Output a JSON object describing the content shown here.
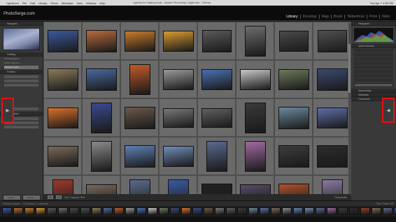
{
  "menubar": {
    "apple": "",
    "items": [
      "Lightroom",
      "File",
      "Edit",
      "Library",
      "Photo",
      "Metadata",
      "View",
      "Window",
      "Help"
    ],
    "window_title": "Lightroom Catalog.lrcat - Adobe Photoshop Lightroom - Library",
    "clock": "Tue Apr 7  4:50 PM"
  },
  "identity": {
    "brand": "PhotoSerge.com"
  },
  "modules": [
    "Library",
    "Develop",
    "Map",
    "Book",
    "Slideshow",
    "Print",
    "Web"
  ],
  "active_module": "Library",
  "left_panel": {
    "navigator": "Navigator",
    "catalog": "Catalog",
    "catalog_rows": [
      "All Photographs",
      "Quick Collection +",
      "Previous Import"
    ],
    "folders": "Folders",
    "collections": "Collections"
  },
  "right_panel": {
    "histogram": "Histogram",
    "quick_develop": "Quick Develop",
    "keywording": "Keywording",
    "metadata": "Metadata",
    "comments": "Comments"
  },
  "toolbar": {
    "sort": "Sort: Capture Time",
    "thumbnails": "Thumbnails"
  },
  "buttons": {
    "import": "Import...",
    "export": "Export..."
  },
  "filmstrip_bar": {
    "source": "Previous Import",
    "count": "122 photos / 1 selected",
    "filter": "Filter: Filters Off"
  },
  "colors": {
    "highlight_border": "#e81010",
    "active_module": "#ffffff"
  },
  "grid_cells": [
    {
      "c": "#3c5a9e",
      "w": 44,
      "h": 32
    },
    {
      "c": "#b76a3a",
      "w": 44,
      "h": 32
    },
    {
      "c": "#c77b2b",
      "w": 44,
      "h": 30
    },
    {
      "c": "#d99a32",
      "w": 44,
      "h": 30
    },
    {
      "c": "#5a5a5a",
      "w": 42,
      "h": 32
    },
    {
      "c": "#6d6d6d",
      "w": 30,
      "h": 44
    },
    {
      "c": "#4a4a4a",
      "w": 42,
      "h": 30
    },
    {
      "c": "#505050",
      "w": 42,
      "h": 32
    },
    {
      "c": "#8a7a5a",
      "w": 44,
      "h": 32
    },
    {
      "c": "#4a6aa0",
      "w": 44,
      "h": 32
    },
    {
      "c": "#c25a2a",
      "w": 30,
      "h": 44
    },
    {
      "c": "#9a9a9a",
      "w": 44,
      "h": 30
    },
    {
      "c": "#4a70b0",
      "w": 44,
      "h": 30
    },
    {
      "c": "#c8c8c8",
      "w": 44,
      "h": 30
    },
    {
      "c": "#6c7a5a",
      "w": 44,
      "h": 30
    },
    {
      "c": "#3a4a70",
      "w": 44,
      "h": 32
    },
    {
      "c": "#d9702a",
      "w": 44,
      "h": 30
    },
    {
      "c": "#3a4a8e",
      "w": 30,
      "h": 44
    },
    {
      "c": "#6a5a4a",
      "w": 44,
      "h": 32
    },
    {
      "c": "#787878",
      "w": 44,
      "h": 28
    },
    {
      "c": "#606060",
      "w": 44,
      "h": 28
    },
    {
      "c": "#3a3a3a",
      "w": 30,
      "h": 44
    },
    {
      "c": "#6a8a9e",
      "w": 44,
      "h": 32
    },
    {
      "c": "#5c6ea8",
      "w": 44,
      "h": 30
    },
    {
      "c": "#7a6a5a",
      "w": 44,
      "h": 30
    },
    {
      "c": "#8a8a8a",
      "w": 30,
      "h": 44
    },
    {
      "c": "#5f80b5",
      "w": 44,
      "h": 32
    },
    {
      "c": "#6f8eb8",
      "w": 44,
      "h": 30
    },
    {
      "c": "#5a6a90",
      "w": 30,
      "h": 44
    },
    {
      "c": "#a06aa0",
      "w": 30,
      "h": 44
    },
    {
      "c": "#3c3c3c",
      "w": 44,
      "h": 32
    },
    {
      "c": "#2c2c2c",
      "w": 44,
      "h": 32
    },
    {
      "c": "#9a3a2a",
      "w": 30,
      "h": 44
    },
    {
      "c": "#7a6a5a",
      "w": 44,
      "h": 30
    },
    {
      "c": "#5a6a8a",
      "w": 30,
      "h": 44
    },
    {
      "c": "#3a5aa0",
      "w": 30,
      "h": 44
    },
    {
      "c": "#222222",
      "w": 44,
      "h": 32
    },
    {
      "c": "#5a4a6a",
      "w": 44,
      "h": 30
    },
    {
      "c": "#b0502a",
      "w": 44,
      "h": 32
    },
    {
      "c": "#8a7aa0",
      "w": 30,
      "h": 44
    }
  ],
  "filmstrip": [
    "#3c5a9e",
    "#b76a3a",
    "#c77b2b",
    "#d99a32",
    "#5a5a5a",
    "#6d6d6d",
    "#4a4a4a",
    "#505050",
    "#8a7a5a",
    "#4a6aa0",
    "#c25a2a",
    "#9a9a9a",
    "#4a70b0",
    "#c8c8c8",
    "#6c7a5a",
    "#3a4a70",
    "#d9702a",
    "#3a4a8e",
    "#6a5a4a",
    "#787878",
    "#606060",
    "#3a3a3a",
    "#6a8a9e",
    "#5c6ea8",
    "#7a6a5a",
    "#8a8a8a",
    "#5f80b5",
    "#6f8eb8",
    "#5a6a90",
    "#a06aa0",
    "#3c3c3c",
    "#2c2c2c",
    "#9a3a2a",
    "#7a6a5a",
    "#5a6a8a",
    "#3a5aa0",
    "#222222",
    "#5a4a6a"
  ]
}
